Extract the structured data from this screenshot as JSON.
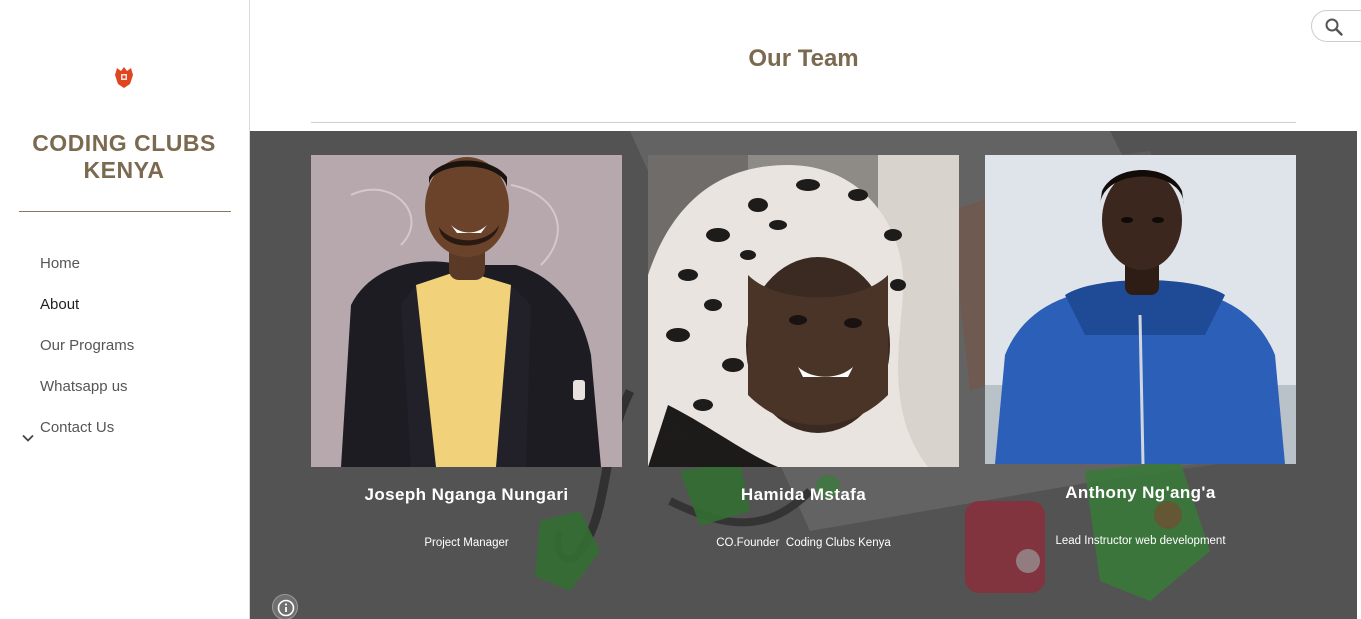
{
  "sidebar": {
    "site_title": "CODING CLUBS KENYA",
    "logo_icon": "kenya-coat-of-arms-icon",
    "nav": [
      {
        "label": "Home",
        "active": false
      },
      {
        "label": "About",
        "active": true
      },
      {
        "label": "Our Programs",
        "active": false
      },
      {
        "label": "Whatsapp us",
        "active": false
      },
      {
        "label": "Contact Us",
        "active": false,
        "expandable": true,
        "icon": "chevron-down-icon"
      }
    ]
  },
  "header": {
    "search_icon": "search-icon"
  },
  "main": {
    "title": "Our Team",
    "team": [
      {
        "name": "Joseph Nganga Nungari",
        "role": "Project Manager"
      },
      {
        "name": "Hamida Mstafa",
        "role": "CO.Founder  Coding Clubs Kenya"
      },
      {
        "name": "Anthony Ng'ang'a",
        "role": "Lead Instructor web development"
      }
    ],
    "info_icon": "info-icon"
  },
  "colors": {
    "accent": "#7b6a4f",
    "section_overlay": "#5d5d5d",
    "logo": "#e0451f"
  }
}
